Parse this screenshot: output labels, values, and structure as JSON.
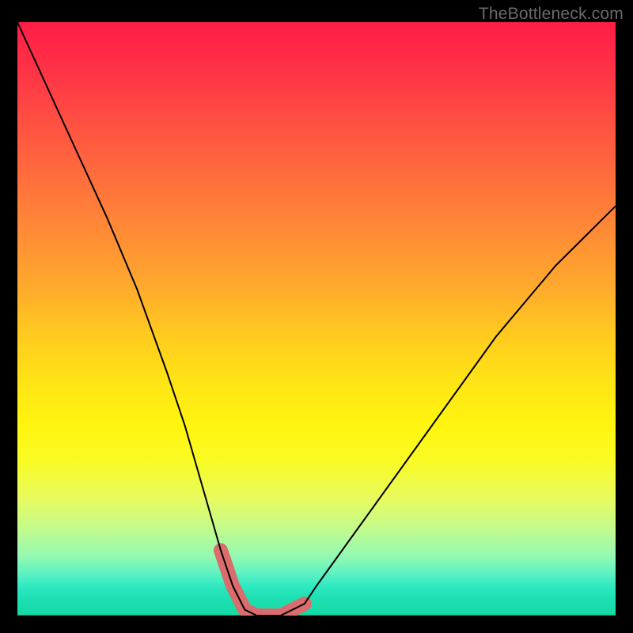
{
  "watermark": {
    "text": "TheBottleneck.com"
  },
  "colors": {
    "curve": "#000000",
    "highlight_band": "#da6c6d",
    "frame": "#000000"
  },
  "chart_data": {
    "type": "line",
    "title": "",
    "xlabel": "",
    "ylabel": "",
    "xlim": [
      0,
      100
    ],
    "ylim": [
      0,
      100
    ],
    "grid": false,
    "legend": false,
    "series": [
      {
        "name": "bottleneck-curve",
        "x": [
          0,
          5,
          10,
          15,
          20,
          25,
          28,
          30,
          32,
          34,
          36,
          38,
          40,
          42,
          44,
          46,
          48,
          50,
          55,
          60,
          65,
          70,
          75,
          80,
          85,
          90,
          95,
          100
        ],
        "values": [
          100,
          89,
          78,
          67,
          55,
          41,
          32,
          25,
          18,
          11,
          5,
          1,
          0,
          0,
          0,
          1,
          2,
          5,
          12,
          19,
          26,
          33,
          40,
          47,
          53,
          59,
          64,
          69
        ]
      }
    ],
    "highlight_range": {
      "x_start": 34,
      "x_end": 48,
      "description": "optimal-balance-band"
    },
    "background_gradient": {
      "top_color": "#ff1d46",
      "mid_color": "#fff50f",
      "bottom_color": "#14daa4"
    }
  }
}
